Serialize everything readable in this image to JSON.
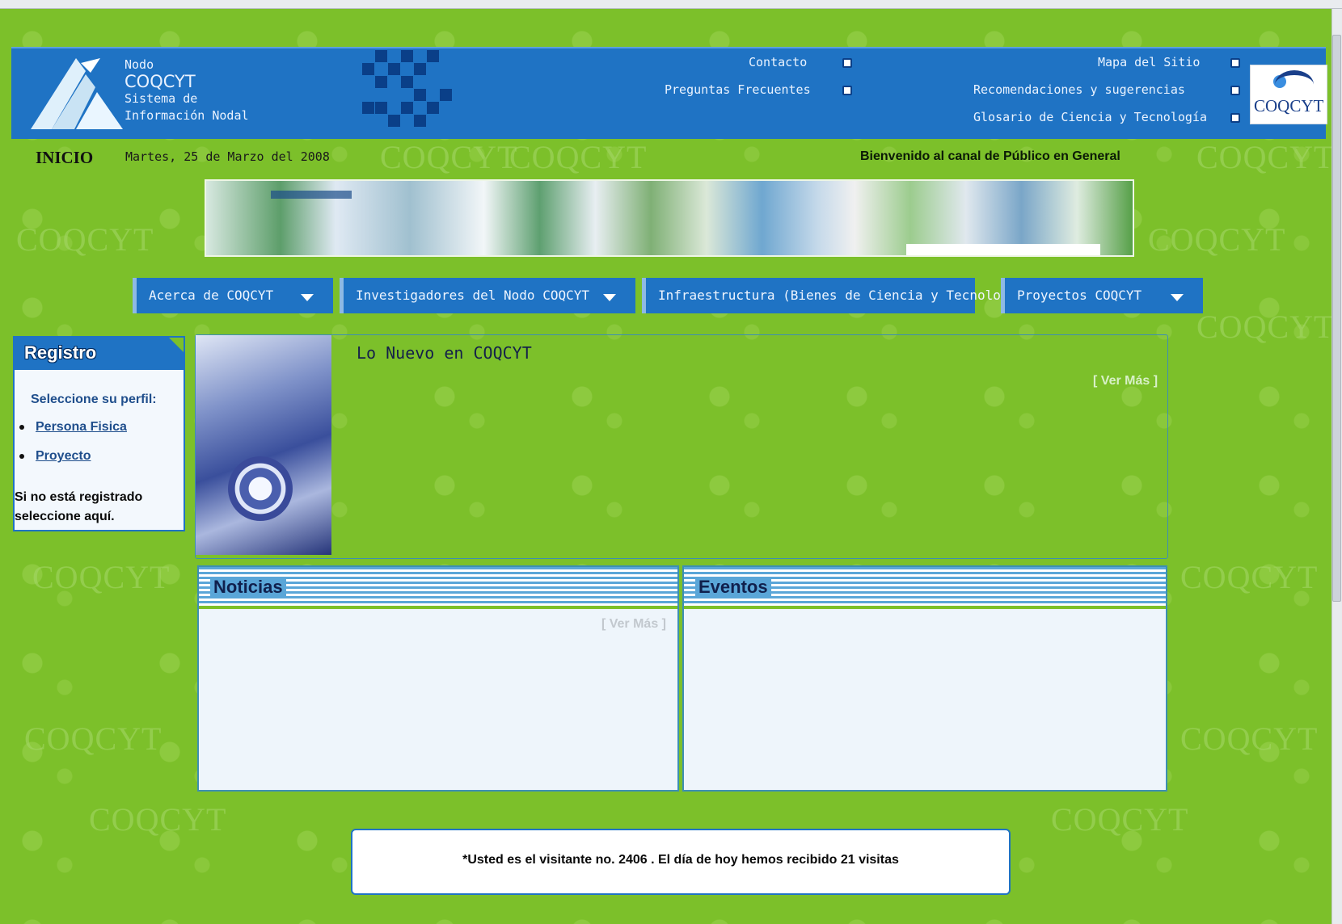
{
  "header": {
    "brand": {
      "line1": "Nodo",
      "line2": "COQCYT",
      "line3": "Sistema de",
      "line4": "Información Nodal"
    },
    "links": {
      "contacto": "Contacto",
      "preguntas": "Preguntas Frecuentes",
      "mapa": "Mapa del Sitio",
      "recomendaciones": "Recomendaciones y sugerencias",
      "glosario": "Glosario de Ciencia y Tecnología"
    },
    "corner_logo_text": "COQCYT"
  },
  "subheader": {
    "inicio": "INICIO",
    "date": "Martes, 25 de Marzo del 2008",
    "welcome": "Bienvenido al canal de Público en General"
  },
  "nav": {
    "acerca": "Acerca de COQCYT",
    "investigadores": "Investigadores del Nodo COQCYT",
    "infraestructura": "Infraestructura (Bienes de Ciencia y Tecnología)",
    "proyectos": "Proyectos COQCYT"
  },
  "registro": {
    "title": "Registro",
    "select_profile": "Seleccione su perfil:",
    "options": [
      "Persona Fisica",
      "Proyecto"
    ],
    "not_registered": "Si no está registrado seleccione aquí."
  },
  "nuevo": {
    "title": "Lo Nuevo en COQCYT",
    "ver_mas": "[ Ver Más ]"
  },
  "noticias": {
    "title": "Noticias",
    "ver_mas": "[ Ver Más ]"
  },
  "eventos": {
    "title": "Eventos"
  },
  "watermark_text": "COQCYT",
  "footer": {
    "visits": "*Usted es el visitante no. 2406 .  El día de hoy hemos recibido 21 visitas"
  },
  "colors": {
    "background_green": "#7cc02a",
    "header_blue": "#1f73c4",
    "dark_blue": "#0a3f88"
  }
}
